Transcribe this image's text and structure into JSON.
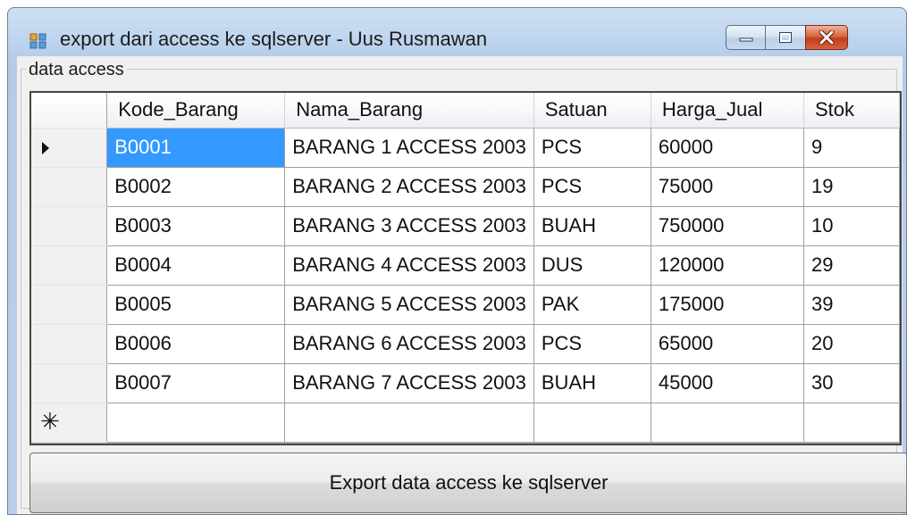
{
  "window": {
    "title": "export dari access ke sqlserver - Uus Rusmawan",
    "buttons": [
      "minimize-icon",
      "maximize-icon",
      "close-icon"
    ]
  },
  "group": {
    "label": "data access"
  },
  "grid": {
    "columns": [
      "Kode_Barang",
      "Nama_Barang",
      "Satuan",
      "Harga_Jual",
      "Stok"
    ],
    "rows": [
      [
        "B0001",
        "BARANG 1 ACCESS 2003",
        "PCS",
        "60000",
        "9"
      ],
      [
        "B0002",
        "BARANG 2 ACCESS 2003",
        "PCS",
        "75000",
        "19"
      ],
      [
        "B0003",
        "BARANG 3 ACCESS 2003",
        "BUAH",
        "750000",
        "10"
      ],
      [
        "B0004",
        "BARANG 4 ACCESS 2003",
        "DUS",
        "120000",
        "29"
      ],
      [
        "B0005",
        "BARANG 5 ACCESS 2003",
        "PAK",
        "175000",
        "39"
      ],
      [
        "B0006",
        "BARANG 6 ACCESS 2003",
        "PCS",
        "65000",
        "20"
      ],
      [
        "B0007",
        "BARANG 7 ACCESS 2003",
        "BUAH",
        "45000",
        "30"
      ]
    ],
    "current_row_marker": "▶",
    "new_row_marker": "✳"
  },
  "export_button": {
    "label": "Export data access ke sqlserver"
  },
  "colors": {
    "selection": "#3399ff",
    "close_button": "#c84a28"
  }
}
